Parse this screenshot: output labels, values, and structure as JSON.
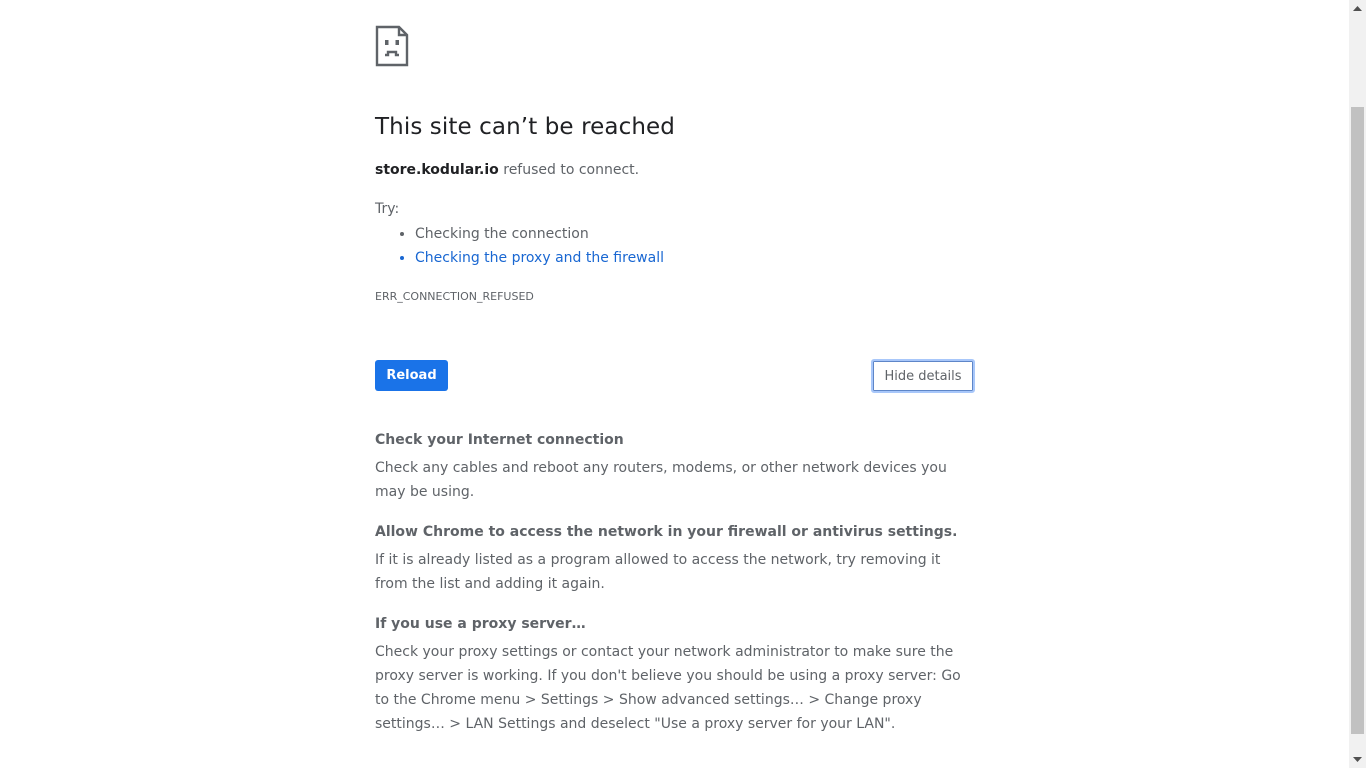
{
  "error_page": {
    "title": "This site can’t be reached",
    "host": "store.kodular.io",
    "summary_suffix": " refused to connect.",
    "try_label": "Try:",
    "suggestions": [
      {
        "label": "Checking the connection",
        "is_link": false
      },
      {
        "label": "Checking the proxy and the firewall",
        "is_link": true
      }
    ],
    "error_code": "ERR_CONNECTION_REFUSED",
    "reload_label": "Reload",
    "details_label": "Hide details",
    "details": [
      {
        "heading": "Check your Internet connection",
        "body": "Check any cables and reboot any routers, modems, or other network devices you may be using."
      },
      {
        "heading": "Allow Chrome to access the network in your firewall or antivirus settings.",
        "body": "If it is already listed as a program allowed to access the network, try removing it from the list and adding it again."
      },
      {
        "heading": "If you use a proxy server…",
        "body": "Check your proxy settings or contact your network administrator to make sure the proxy server is working. If you don't believe you should be using a proxy server: Go to the Chrome menu > Settings > Show advanced settings… > Change proxy settings… > LAN Settings and deselect \"Use a proxy server for your LAN\"."
      }
    ]
  },
  "icons": {
    "main_icon": "sad-page-icon",
    "scroll_up": "chevron-up-icon",
    "scroll_down": "chevron-down-icon"
  },
  "colors": {
    "accent": "#1a73e8",
    "link": "#1967d2",
    "text_primary": "#202124",
    "text_secondary": "#5f6368"
  }
}
